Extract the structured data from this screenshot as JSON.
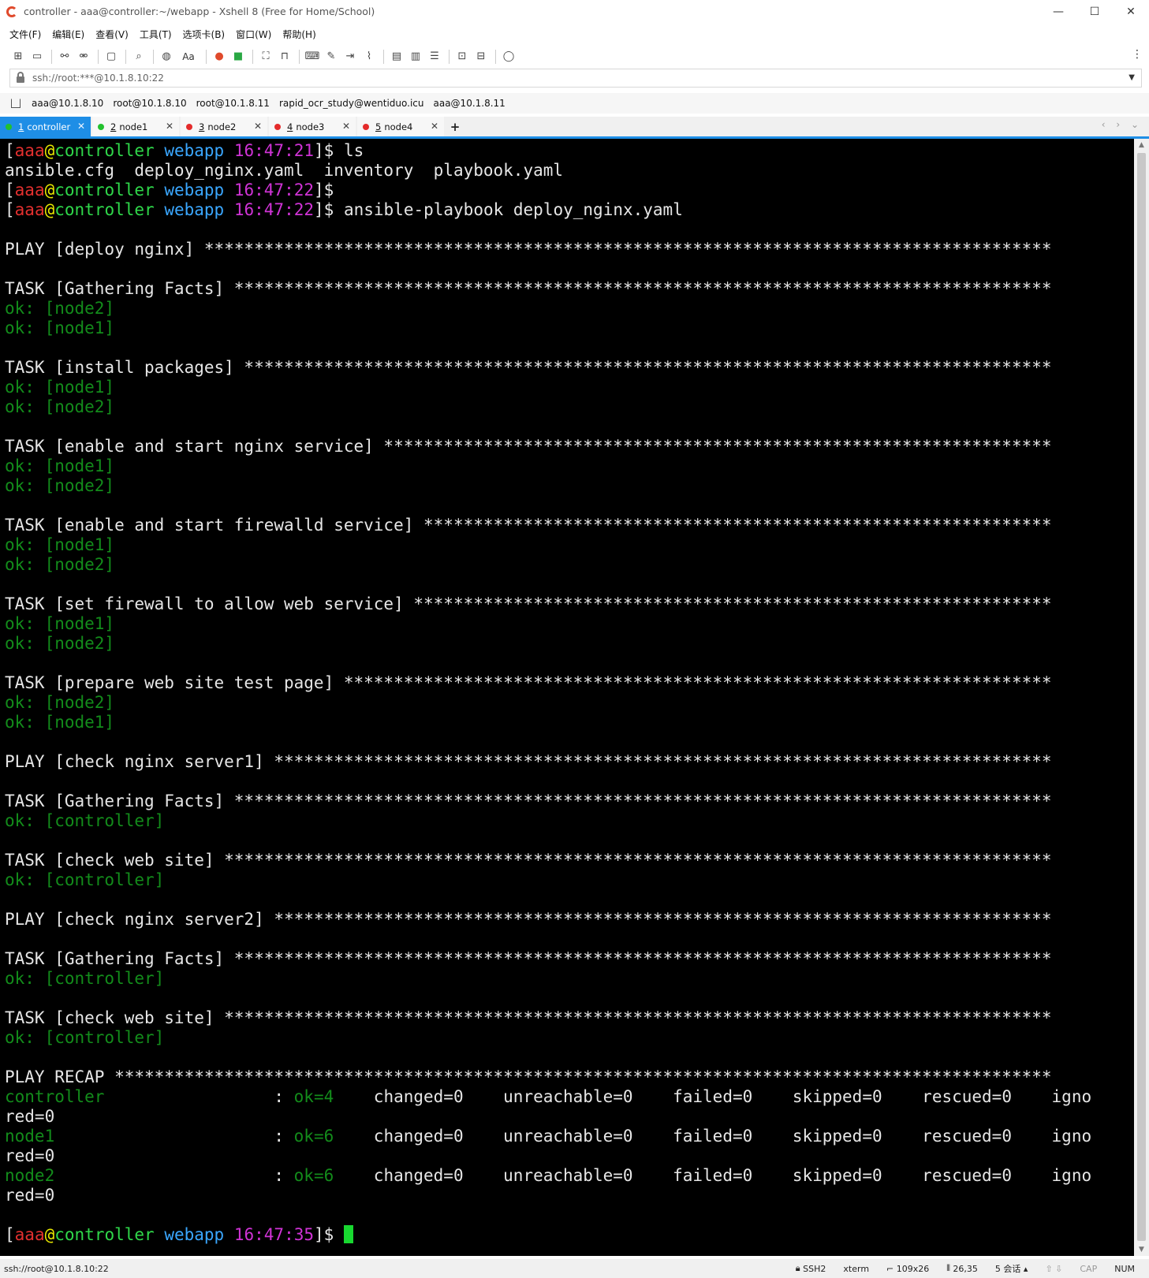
{
  "window": {
    "title": "controller - aaa@controller:~/webapp - Xshell 8 (Free for Home/School)",
    "controls": {
      "minimize": "—",
      "maximize": "☐",
      "close": "✕"
    }
  },
  "menu": [
    "文件(F)",
    "编辑(E)",
    "查看(V)",
    "工具(T)",
    "选项卡(B)",
    "窗口(W)",
    "帮助(H)"
  ],
  "toolbar": {
    "font_label": "Aa"
  },
  "address": {
    "value": "ssh://root:***@10.1.8.10:22"
  },
  "bookmarks": [
    "aaa@10.1.8.10",
    "root@10.1.8.10",
    "root@10.1.8.11",
    "rapid_ocr_study@wentiduo.icu",
    "aaa@10.1.8.11"
  ],
  "tabs": [
    {
      "index": "1",
      "name": "controller",
      "color": "#22c12e",
      "active": true
    },
    {
      "index": "2",
      "name": "node1",
      "color": "#22c12e",
      "active": false
    },
    {
      "index": "3",
      "name": "node2",
      "color": "#e42b2b",
      "active": false
    },
    {
      "index": "4",
      "name": "node3",
      "color": "#e42b2b",
      "active": false
    },
    {
      "index": "5",
      "name": "node4",
      "color": "#e42b2b",
      "active": false
    }
  ],
  "prompt": {
    "user": "aaa",
    "host": "controller",
    "dir": "webapp"
  },
  "terminal": {
    "ls_cmd": "ls",
    "ls_output": "ansible.cfg  deploy_nginx.yaml  inventory  playbook.yaml",
    "playbook_cmd": "ansible-playbook deploy_nginx.yaml",
    "time1": "16:47:21",
    "time2": "16:47:22",
    "time3": "16:47:22",
    "time_final": "16:47:35",
    "plays": [
      {
        "header": "PLAY [deploy nginx] *************************************************************************************",
        "tasks": [
          {
            "header": "TASK [Gathering Facts] **********************************************************************************",
            "results": [
              "ok: [node2]",
              "ok: [node1]"
            ]
          },
          {
            "header": "TASK [install packages] *********************************************************************************",
            "results": [
              "ok: [node1]",
              "ok: [node2]"
            ]
          },
          {
            "header": "TASK [enable and start nginx service] *******************************************************************",
            "results": [
              "ok: [node1]",
              "ok: [node2]"
            ]
          },
          {
            "header": "TASK [enable and start firewalld service] ***************************************************************",
            "results": [
              "ok: [node1]",
              "ok: [node2]"
            ]
          },
          {
            "header": "TASK [set firewall to allow web service] ****************************************************************",
            "results": [
              "ok: [node1]",
              "ok: [node2]"
            ]
          },
          {
            "header": "TASK [prepare web site test page] ***********************************************************************",
            "results": [
              "ok: [node2]",
              "ok: [node1]"
            ]
          }
        ]
      },
      {
        "header": "PLAY [check nginx server1] ******************************************************************************",
        "tasks": [
          {
            "header": "TASK [Gathering Facts] **********************************************************************************",
            "results": [
              "ok: [controller]"
            ]
          },
          {
            "header": "TASK [check web site] ***********************************************************************************",
            "results": [
              "ok: [controller]"
            ]
          }
        ]
      },
      {
        "header": "PLAY [check nginx server2] ******************************************************************************",
        "tasks": [
          {
            "header": "TASK [Gathering Facts] **********************************************************************************",
            "results": [
              "ok: [controller]"
            ]
          },
          {
            "header": "TASK [check web site] ***********************************************************************************",
            "results": [
              "ok: [controller]"
            ]
          }
        ]
      }
    ],
    "recap_header": "PLAY RECAP **********************************************************************************************",
    "recap": [
      {
        "host": "controller",
        "ok": "ok=4",
        "rest": "    changed=0    unreachable=0    failed=0    skipped=0    rescued=0    igno",
        "wrap": "red=0"
      },
      {
        "host": "node1",
        "ok": "ok=6",
        "rest": "    changed=0    unreachable=0    failed=0    skipped=0    rescued=0    igno",
        "wrap": "red=0"
      },
      {
        "host": "node2",
        "ok": "ok=6",
        "rest": "    changed=0    unreachable=0    failed=0    skipped=0    rescued=0    igno",
        "wrap": "red=0"
      }
    ]
  },
  "status": {
    "left": "ssh://root@10.1.8.10:22",
    "ssh": "SSH2",
    "term": "xterm",
    "size": "109x26",
    "pos": "26,35",
    "sessions": "5 会话",
    "cap": "CAP",
    "num": "NUM"
  }
}
